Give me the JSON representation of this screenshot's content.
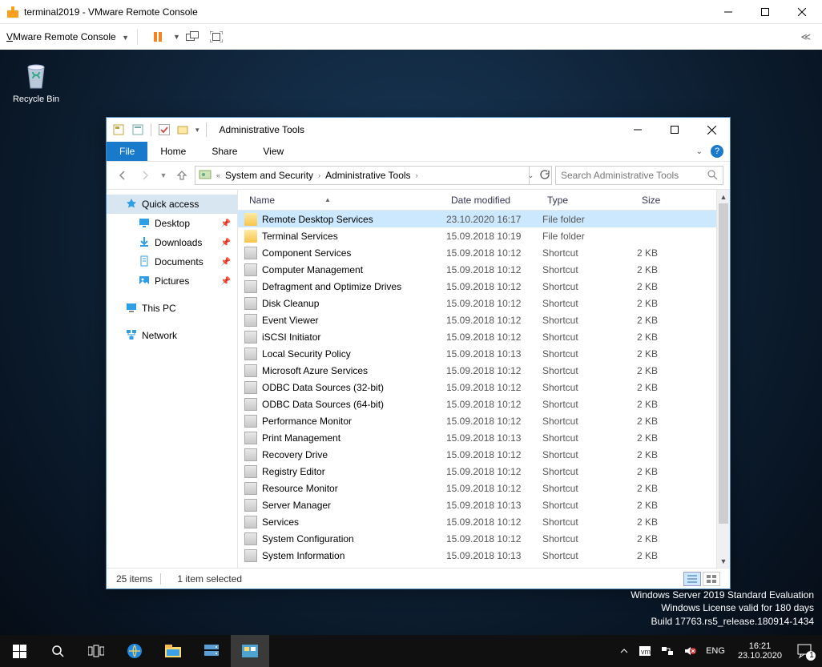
{
  "vmrc": {
    "title": "terminal2019 - VMware Remote Console",
    "menu_label_pre": "V",
    "menu_label_post": "Mware Remote Console"
  },
  "desktop": {
    "recycle_bin": "Recycle Bin"
  },
  "watermark": {
    "line1": "Windows Server 2019 Standard Evaluation",
    "line2": "Windows License valid for 180 days",
    "line3": "Build 17763.rs5_release.180914-1434"
  },
  "taskbar": {
    "lang": "ENG",
    "time": "16:21",
    "date": "23.10.2020",
    "notif_count": "1"
  },
  "explorer": {
    "title": "Administrative Tools",
    "tabs": {
      "file": "File",
      "home": "Home",
      "share": "Share",
      "view": "View"
    },
    "breadcrumb": {
      "seg1": "System and Security",
      "seg2": "Administrative Tools"
    },
    "search_placeholder": "Search Administrative Tools",
    "columns": {
      "name": "Name",
      "date": "Date modified",
      "type": "Type",
      "size": "Size"
    },
    "navpane": {
      "quick_access": "Quick access",
      "desktop": "Desktop",
      "downloads": "Downloads",
      "documents": "Documents",
      "pictures": "Pictures",
      "this_pc": "This PC",
      "network": "Network"
    },
    "rows": [
      {
        "name": "Remote Desktop Services",
        "date": "23.10.2020 16:17",
        "type": "File folder",
        "size": "",
        "icon": "folder",
        "selected": true
      },
      {
        "name": "Terminal Services",
        "date": "15.09.2018 10:19",
        "type": "File folder",
        "size": "",
        "icon": "folder"
      },
      {
        "name": "Component Services",
        "date": "15.09.2018 10:12",
        "type": "Shortcut",
        "size": "2 KB",
        "icon": "shortcut"
      },
      {
        "name": "Computer Management",
        "date": "15.09.2018 10:12",
        "type": "Shortcut",
        "size": "2 KB",
        "icon": "shortcut"
      },
      {
        "name": "Defragment and Optimize Drives",
        "date": "15.09.2018 10:12",
        "type": "Shortcut",
        "size": "2 KB",
        "icon": "shortcut"
      },
      {
        "name": "Disk Cleanup",
        "date": "15.09.2018 10:12",
        "type": "Shortcut",
        "size": "2 KB",
        "icon": "shortcut"
      },
      {
        "name": "Event Viewer",
        "date": "15.09.2018 10:12",
        "type": "Shortcut",
        "size": "2 KB",
        "icon": "shortcut"
      },
      {
        "name": "iSCSI Initiator",
        "date": "15.09.2018 10:12",
        "type": "Shortcut",
        "size": "2 KB",
        "icon": "shortcut"
      },
      {
        "name": "Local Security Policy",
        "date": "15.09.2018 10:13",
        "type": "Shortcut",
        "size": "2 KB",
        "icon": "shortcut"
      },
      {
        "name": "Microsoft Azure Services",
        "date": "15.09.2018 10:12",
        "type": "Shortcut",
        "size": "2 KB",
        "icon": "shortcut"
      },
      {
        "name": "ODBC Data Sources (32-bit)",
        "date": "15.09.2018 10:12",
        "type": "Shortcut",
        "size": "2 KB",
        "icon": "shortcut"
      },
      {
        "name": "ODBC Data Sources (64-bit)",
        "date": "15.09.2018 10:12",
        "type": "Shortcut",
        "size": "2 KB",
        "icon": "shortcut"
      },
      {
        "name": "Performance Monitor",
        "date": "15.09.2018 10:12",
        "type": "Shortcut",
        "size": "2 KB",
        "icon": "shortcut"
      },
      {
        "name": "Print Management",
        "date": "15.09.2018 10:13",
        "type": "Shortcut",
        "size": "2 KB",
        "icon": "shortcut"
      },
      {
        "name": "Recovery Drive",
        "date": "15.09.2018 10:12",
        "type": "Shortcut",
        "size": "2 KB",
        "icon": "shortcut"
      },
      {
        "name": "Registry Editor",
        "date": "15.09.2018 10:12",
        "type": "Shortcut",
        "size": "2 KB",
        "icon": "shortcut"
      },
      {
        "name": "Resource Monitor",
        "date": "15.09.2018 10:12",
        "type": "Shortcut",
        "size": "2 KB",
        "icon": "shortcut"
      },
      {
        "name": "Server Manager",
        "date": "15.09.2018 10:13",
        "type": "Shortcut",
        "size": "2 KB",
        "icon": "shortcut"
      },
      {
        "name": "Services",
        "date": "15.09.2018 10:12",
        "type": "Shortcut",
        "size": "2 KB",
        "icon": "shortcut"
      },
      {
        "name": "System Configuration",
        "date": "15.09.2018 10:12",
        "type": "Shortcut",
        "size": "2 KB",
        "icon": "shortcut"
      },
      {
        "name": "System Information",
        "date": "15.09.2018 10:13",
        "type": "Shortcut",
        "size": "2 KB",
        "icon": "shortcut"
      }
    ],
    "status": {
      "count": "25 items",
      "selection": "1 item selected"
    }
  }
}
